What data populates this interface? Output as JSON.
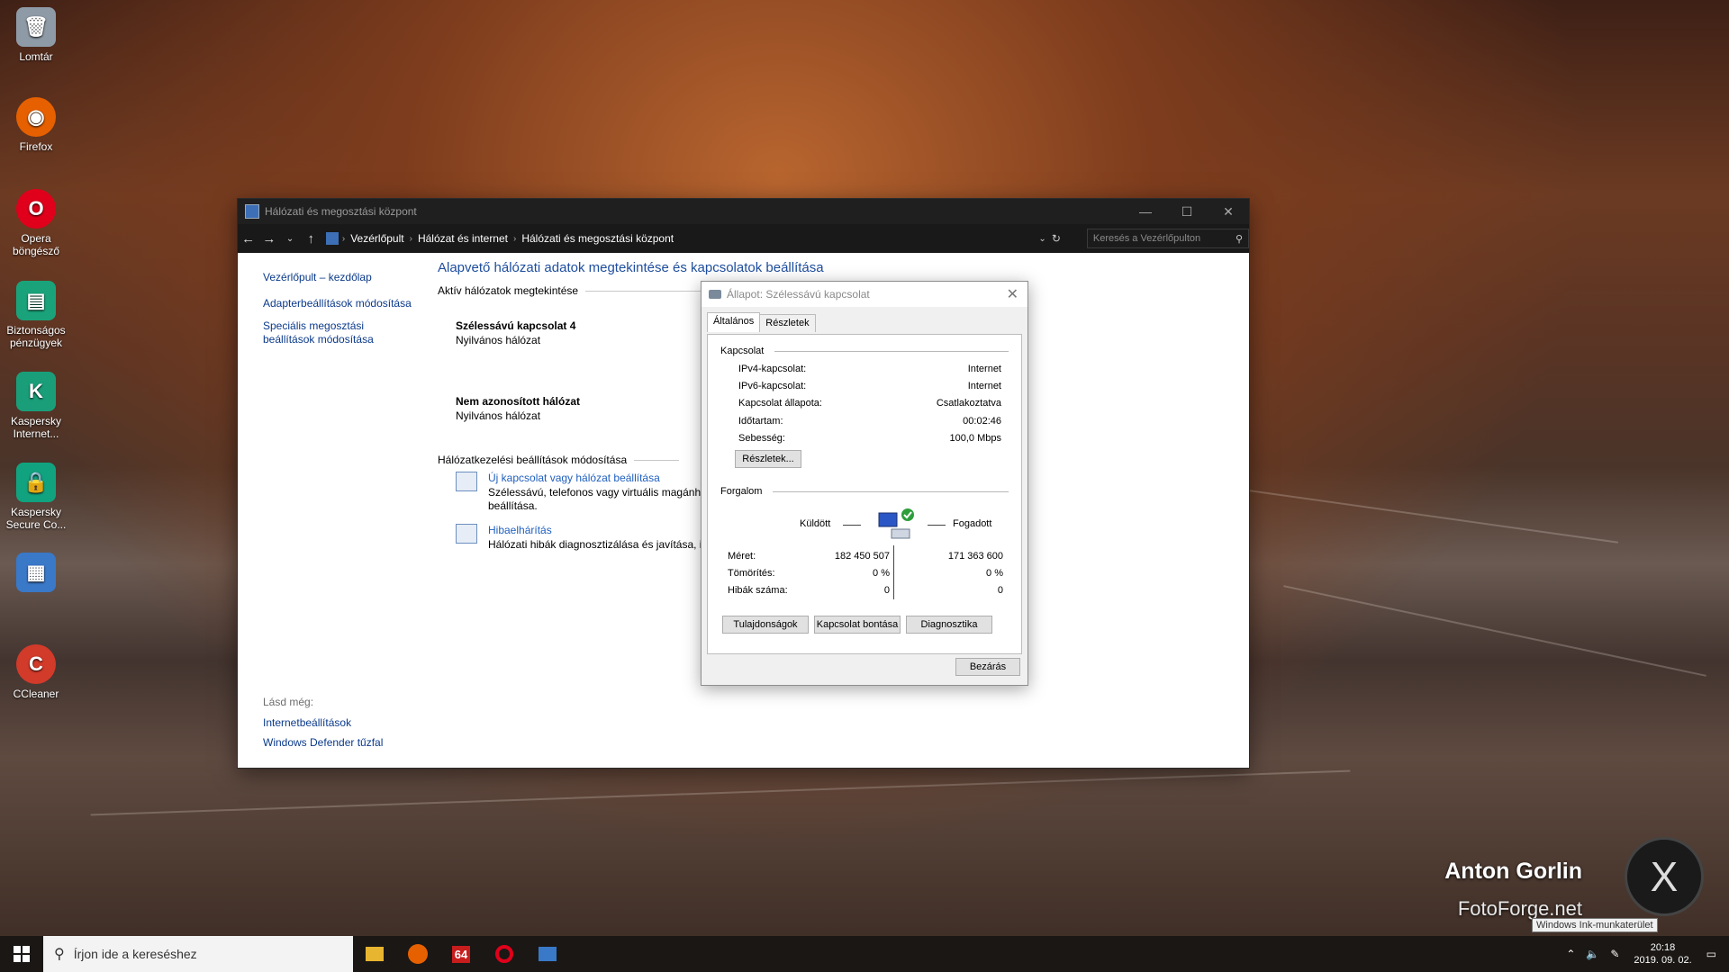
{
  "desktop": {
    "icons": [
      {
        "label": "Lomtár",
        "icon": "recycle-bin-icon",
        "color": "#9aa6b2"
      },
      {
        "label": "Firefox",
        "icon": "firefox-icon",
        "color": "#e66000"
      },
      {
        "label": "Opera böngésző",
        "icon": "opera-icon",
        "color": "#e0001b"
      },
      {
        "label": "Biztonságos pénzügyek",
        "icon": "safe-money-icon",
        "color": "#1aa37a"
      },
      {
        "label": "Kaspersky Internet...",
        "icon": "kaspersky-internet-icon",
        "color": "#1a9e7a"
      },
      {
        "label": "Kaspersky Secure Co...",
        "icon": "kaspersky-secure-icon",
        "color": "#11a37f"
      },
      {
        "label": "",
        "icon": "control-panel-shortcut-icon",
        "color": "#3a78c8"
      },
      {
        "label": "CCleaner",
        "icon": "ccleaner-icon",
        "color": "#d23a2a"
      }
    ],
    "watermark": {
      "name": "Anton Gorlin",
      "site": "FotoForge.net"
    },
    "ink_tooltip": "Windows Ink-munkaterület"
  },
  "window": {
    "title": "Hálózati és megosztási központ",
    "breadcrumbs": [
      "Vezérlőpult",
      "Hálózat és internet",
      "Hálózati és megosztási központ"
    ],
    "search_placeholder": "Keresés a Vezérlőpulton",
    "sidebar": [
      "Vezérlőpult – kezdőlap",
      "Adapterbeállítások módosítása",
      "Speciális megosztási beállítások módosítása"
    ],
    "see_also_label": "Lásd még:",
    "see_also": [
      "Internetbeállítások",
      "Windows Defender tűzfal"
    ],
    "heading": "Alapvető hálózati adatok megtekintése és kapcsolatok beállítása",
    "active_networks_label": "Aktív hálózatok megtekintése",
    "networks": [
      {
        "name": "Szélessávú kapcsolat 4",
        "type": "Nyilvános hálózat"
      },
      {
        "name": "Nem azonosított hálózat",
        "type": "Nyilvános hálózat"
      }
    ],
    "change_settings_label": "Hálózatkezelési beállítások módosítása",
    "tasks": [
      {
        "link": "Új kapcsolat vagy hálózat beállítása",
        "desc1": "Szélessávú, telefonos vagy virtuális magánhál",
        "desc2": "beállítása."
      },
      {
        "link": "Hibaelhárítás",
        "desc1": "Hálózati hibák diagnosztizálása és javítása, ille",
        "desc2": ""
      }
    ]
  },
  "dialog": {
    "title": "Állapot: Szélessávú kapcsolat",
    "tabs": [
      "Általános",
      "Részletek"
    ],
    "connection_group": "Kapcsolat",
    "connection": [
      {
        "k": "IPv4-kapcsolat:",
        "v": "Internet"
      },
      {
        "k": "IPv6-kapcsolat:",
        "v": "Internet"
      },
      {
        "k": "Kapcsolat állapota:",
        "v": "Csatlakoztatva"
      },
      {
        "k": "Időtartam:",
        "v": "00:02:46"
      },
      {
        "k": "Sebesség:",
        "v": "100,0 Mbps"
      }
    ],
    "details_button": "Részletek...",
    "traffic_group": "Forgalom",
    "sent_label": "Küldött",
    "received_label": "Fogadott",
    "traffic": [
      {
        "k": "Méret:",
        "sent": "182 450 507",
        "recv": "171 363 600"
      },
      {
        "k": "Tömörítés:",
        "sent": "0 %",
        "recv": "0 %"
      },
      {
        "k": "Hibák száma:",
        "sent": "0",
        "recv": "0"
      }
    ],
    "buttons": [
      "Tulajdonságok",
      "Kapcsolat bontása",
      "Diagnosztika"
    ],
    "close_button": "Bezárás"
  },
  "taskbar": {
    "search_placeholder": "Írjon ide a kereséshez",
    "apps": [
      "file-explorer-icon",
      "firefox-icon",
      "aida64-icon",
      "opera-icon",
      "control-panel-icon"
    ],
    "aida_label": "64",
    "time": "20:18",
    "date": "2019. 09. 02."
  }
}
